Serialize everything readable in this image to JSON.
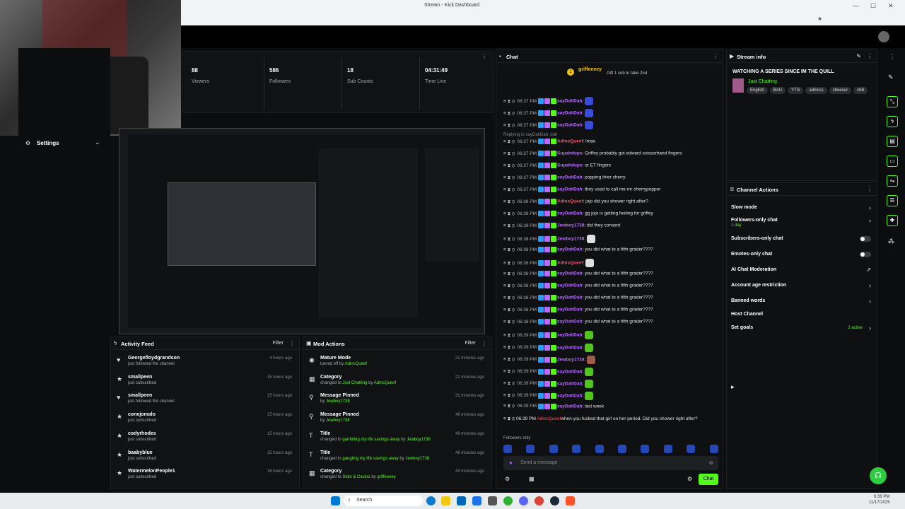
{
  "browser": {
    "title": "Stream - Kick Dashboard"
  },
  "stats": [
    {
      "value": "88",
      "label": "Viewers"
    },
    {
      "value": "586",
      "label": "Followers"
    },
    {
      "value": "18",
      "label": "Sub Counts"
    },
    {
      "value": "04:31:49",
      "label": "Time Live"
    }
  ],
  "settings": {
    "label": "Settings"
  },
  "activity_feed": {
    "title": "Activity Feed",
    "filter": "Filter",
    "items": [
      {
        "name": "Georgefloydgrandson",
        "action": "just followed the channel",
        "time": "4 hours ago",
        "icon": "heart-icon"
      },
      {
        "name": "smallpeen",
        "action": "just subscribed",
        "time": "15 hours ago",
        "icon": "star-icon"
      },
      {
        "name": "smallpeen",
        "action": "just followed the channel",
        "time": "15 hours ago",
        "icon": "heart-icon"
      },
      {
        "name": "conejomalo",
        "action": "just subscribed",
        "time": "15 hours ago",
        "icon": "star-icon"
      },
      {
        "name": "codyrhodes",
        "action": "just subscribed",
        "time": "15 hours ago",
        "icon": "star-icon"
      },
      {
        "name": "baabyblue",
        "action": "just subscribed",
        "time": "15 hours ago",
        "icon": "star-icon"
      },
      {
        "name": "WatermelonPeople1",
        "action": "just subscribed",
        "time": "16 hours ago",
        "icon": "star-icon"
      }
    ]
  },
  "mod_actions": {
    "title": "Mod Actions",
    "filter": "Filter",
    "items": [
      {
        "title": "Mature Mode",
        "pre": "turned off by",
        "value": "",
        "by": "",
        "user": "AdinsQueef",
        "time": "21 minutes ago",
        "icon": "eye-icon"
      },
      {
        "title": "Category",
        "pre": "changed to",
        "value": "Just Chatting",
        "by": "by",
        "user": "AdinsQueef",
        "time": "21 minutes ago",
        "icon": "category-icon"
      },
      {
        "title": "Message Pinned",
        "pre": "by",
        "value": "",
        "by": "",
        "user": "Jewboy1738",
        "time": "31 minutes ago",
        "icon": "pin-icon"
      },
      {
        "title": "Message Pinned",
        "pre": "by",
        "value": "",
        "by": "",
        "user": "Jewboy1738",
        "time": "48 minutes ago",
        "icon": "pin-icon"
      },
      {
        "title": "Title",
        "pre": "changed to",
        "value": "gambling my life savings away",
        "by": "by",
        "user": "Jewboy1738",
        "time": "48 minutes ago",
        "icon": "title-icon"
      },
      {
        "title": "Title",
        "pre": "changed to",
        "value": "gangling my life savings away",
        "by": "by",
        "user": "Jewboy1738",
        "time": "48 minutes ago",
        "icon": "title-icon"
      },
      {
        "title": "Category",
        "pre": "changed to",
        "value": "Slots & Casino",
        "by": "by",
        "user": "griffeeeey",
        "time": "49 minutes ago",
        "icon": "category-icon"
      }
    ]
  },
  "chat": {
    "title": "Chat",
    "pinned_user": "griffeeeey",
    "pinned_text": "Gift 1 sub to take 2nd",
    "reply_to": "Replying to sayDahDah: duh",
    "followers_only": "Followers only",
    "placeholder": "Send a message",
    "send_label": "Chat",
    "messages": [
      {
        "time": "06:37 PM",
        "user": "sayDahDah",
        "color": "#b86cff",
        "msg": "",
        "emote": "#3a4bd6"
      },
      {
        "time": "06:37 PM",
        "user": "sayDahDah",
        "color": "#b86cff",
        "msg": "",
        "emote": "#3a4bd6"
      },
      {
        "time": "06:37 PM",
        "user": "sayDahDah",
        "color": "#b86cff",
        "msg": "",
        "emote": "#3a4bd6"
      },
      {
        "time": "06:37 PM",
        "user": "AdinsQueef",
        "color": "#ff4d6d",
        "msg": "lmao",
        "emote": ""
      },
      {
        "time": "06:37 PM",
        "user": "Supahdups",
        "color": "#b86cff",
        "msg": "Griffey probably got edward scissorhand fingers",
        "emote": ""
      },
      {
        "time": "06:37 PM",
        "user": "Supahdups",
        "color": "#b86cff",
        "msg": "or ET fingers",
        "emote": ""
      },
      {
        "time": "06:37 PM",
        "user": "sayDahDah",
        "color": "#b86cff",
        "msg": "popping thier cherry",
        "emote": ""
      },
      {
        "time": "06:37 PM",
        "user": "sayDahDah",
        "color": "#b86cff",
        "msg": "they used to call me mr cherrypopper",
        "emote": ""
      },
      {
        "time": "06:38 PM",
        "user": "AdinsQueef",
        "color": "#ff4d6d",
        "msg": "jojo did you shower right after?",
        "emote": ""
      },
      {
        "time": "06:38 PM",
        "user": "sayDahDah",
        "color": "#b86cff",
        "msg": "gg jojo is getting feeling for griffey",
        "emote": ""
      },
      {
        "time": "06:38 PM",
        "user": "Jewboy1738",
        "color": "#b86cff",
        "msg": "did they consent",
        "emote": ""
      },
      {
        "time": "06:38 PM",
        "user": "Jewboy1738",
        "color": "#b86cff",
        "msg": "",
        "emote": "#e0e0e0"
      },
      {
        "time": "06:38 PM",
        "user": "sayDahDah",
        "color": "#b86cff",
        "msg": "you did what to a fifth grader????",
        "emote": ""
      },
      {
        "time": "06:38 PM",
        "user": "AdinsQueef",
        "color": "#ff4d6d",
        "msg": "",
        "emote": "#e0e0e0"
      },
      {
        "time": "06:38 PM",
        "user": "sayDahDah",
        "color": "#b86cff",
        "msg": "you did what to a fifth grader????",
        "emote": ""
      },
      {
        "time": "06:38 PM",
        "user": "sayDahDah",
        "color": "#b86cff",
        "msg": "you did what to a fifth grader????",
        "emote": ""
      },
      {
        "time": "06:38 PM",
        "user": "sayDahDah",
        "color": "#b86cff",
        "msg": "you did what to a fifth grader????",
        "emote": ""
      },
      {
        "time": "06:38 PM",
        "user": "sayDahDah",
        "color": "#b86cff",
        "msg": "you did what to a fifth grader????",
        "emote": ""
      },
      {
        "time": "06:38 PM",
        "user": "sayDahDah",
        "color": "#b86cff",
        "msg": "you did what to a fifth grader????",
        "emote": ""
      },
      {
        "time": "06:39 PM",
        "user": "sayDahDah",
        "color": "#b86cff",
        "msg": "",
        "emote": "#53c41f"
      },
      {
        "time": "06:39 PM",
        "user": "sayDahDah",
        "color": "#b86cff",
        "msg": "",
        "emote": "#53c41f"
      },
      {
        "time": "06:39 PM",
        "user": "Jewboy1738",
        "color": "#b86cff",
        "msg": "",
        "emote": "#a05a4a"
      },
      {
        "time": "06:39 PM",
        "user": "sayDahDah",
        "color": "#b86cff",
        "msg": "",
        "emote": "#53c41f"
      },
      {
        "time": "06:39 PM",
        "user": "sayDahDah",
        "color": "#b86cff",
        "msg": "",
        "emote": "#53c41f"
      },
      {
        "time": "06:39 PM",
        "user": "sayDahDah",
        "color": "#b86cff",
        "msg": "",
        "emote": "#53c41f"
      },
      {
        "time": "06:39 PM",
        "user": "sayDahDah",
        "color": "#b86cff",
        "msg": "last week",
        "emote": ""
      }
    ],
    "last_message": {
      "time": "06:39 PM",
      "user": "AdinsQueef",
      "msg": "when you fucked that girl on her period. Did you shower right after?"
    }
  },
  "stream_info": {
    "title": "Stream info",
    "stream_title": "WATCHING A SERIES SINCE IM THE QUILL",
    "category": "Just Chatting",
    "tags": [
      "English",
      "BAU",
      "YTG",
      "adinsss",
      "cheesur",
      "chill"
    ]
  },
  "channel_actions": {
    "title": "Channel Actions",
    "items": [
      {
        "label": "Slow mode",
        "sub": "",
        "control": "chevron"
      },
      {
        "label": "Followers-only chat",
        "sub": "1 day",
        "control": "chevron"
      },
      {
        "label": "Subscribers-only chat",
        "sub": "",
        "control": "toggle"
      },
      {
        "label": "Emotes-only chat",
        "sub": "",
        "control": "toggle"
      },
      {
        "label": "AI Chat Moderation",
        "sub": "",
        "control": "external"
      },
      {
        "label": "Account age restriction",
        "sub": "",
        "control": "chevron"
      },
      {
        "label": "Banned words",
        "sub": "",
        "control": "chevron"
      },
      {
        "label": "Host Channel",
        "sub": "",
        "control": ""
      },
      {
        "label": "Set goals",
        "sub": "",
        "control": "chevron"
      }
    ],
    "goals_status": "2 active"
  },
  "taskbar": {
    "search": "Search",
    "time": "6:39 PM",
    "date": "11/17/2025"
  },
  "colors": {
    "accent": "#53fc18",
    "bg": "#0b0d0e",
    "panel": "#101214"
  }
}
